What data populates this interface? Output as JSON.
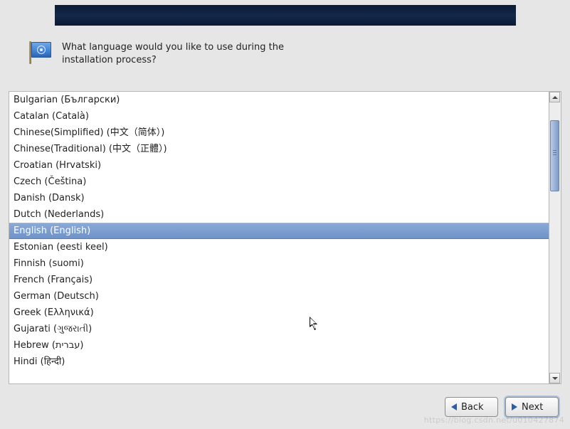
{
  "prompt": "What language would you like to use during the installation process?",
  "languages": [
    {
      "label": "Bulgarian (Български)",
      "selected": false
    },
    {
      "label": "Catalan (Català)",
      "selected": false
    },
    {
      "label": "Chinese(Simplified) (中文（简体）)",
      "selected": false
    },
    {
      "label": "Chinese(Traditional) (中文（正體）)",
      "selected": false
    },
    {
      "label": "Croatian (Hrvatski)",
      "selected": false
    },
    {
      "label": "Czech (Čeština)",
      "selected": false
    },
    {
      "label": "Danish (Dansk)",
      "selected": false
    },
    {
      "label": "Dutch (Nederlands)",
      "selected": false
    },
    {
      "label": "English (English)",
      "selected": true
    },
    {
      "label": "Estonian (eesti keel)",
      "selected": false
    },
    {
      "label": "Finnish (suomi)",
      "selected": false
    },
    {
      "label": "French (Français)",
      "selected": false
    },
    {
      "label": "German (Deutsch)",
      "selected": false
    },
    {
      "label": "Greek (Ελληνικά)",
      "selected": false
    },
    {
      "label": "Gujarati (ગુજરાતી)",
      "selected": false
    },
    {
      "label": "Hebrew (עברית)",
      "selected": false
    },
    {
      "label": "Hindi (हिन्दी)",
      "selected": false
    }
  ],
  "buttons": {
    "back": "Back",
    "next": "Next"
  },
  "icons": {
    "flag": "un-flag-icon",
    "back": "arrow-left-icon",
    "next": "arrow-right-icon"
  },
  "watermark": "https://blog.csdn.net/u010427874"
}
